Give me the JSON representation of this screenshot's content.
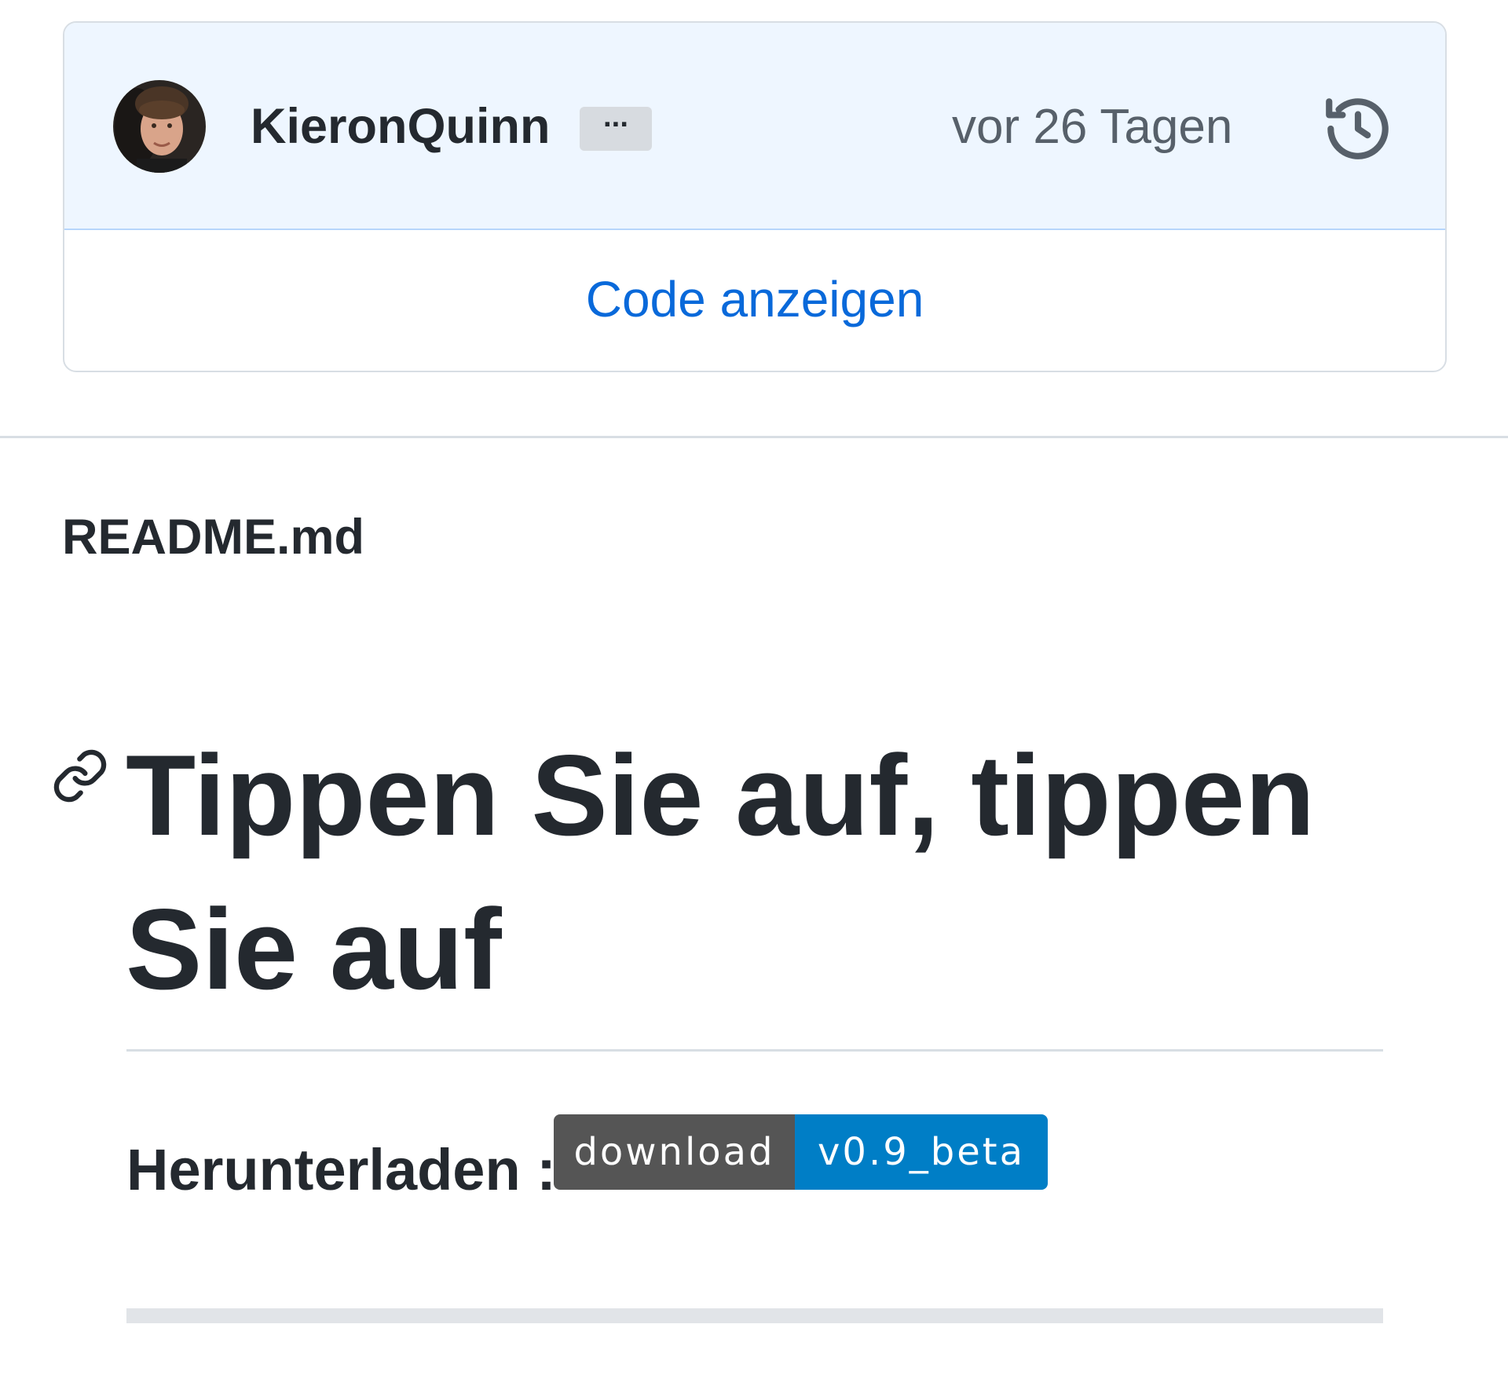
{
  "commit": {
    "author": "KieronQuinn",
    "more_label": "···",
    "time": "vor 26 Tagen",
    "history_icon": "history-icon",
    "view_code_label": "Code anzeigen"
  },
  "readme": {
    "filename": "README.md",
    "anchor_icon": "link-icon",
    "heading": "Tippen Sie auf, tippen Sie auf",
    "download_label": "Herunterladen :",
    "badge": {
      "label": "download",
      "value": "v0.9_beta",
      "label_color": "#555555",
      "value_color": "#007ec6"
    }
  },
  "colors": {
    "link": "#0969da",
    "header_bg": "#eef6ff",
    "text": "#24292f",
    "muted": "#57606a"
  }
}
